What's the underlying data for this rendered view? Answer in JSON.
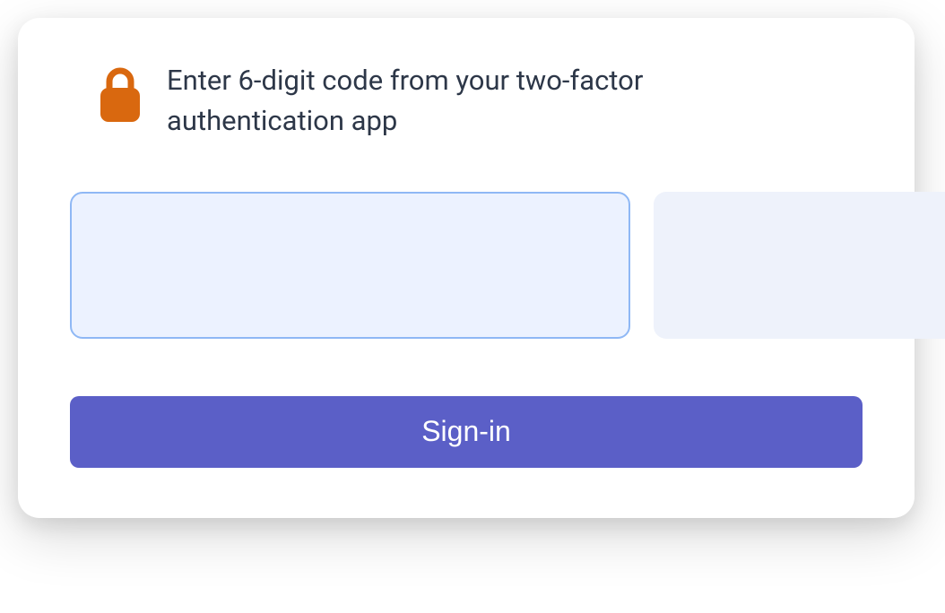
{
  "header": {
    "instruction": "Enter 6-digit code from your two-factor authentication app",
    "icon": "lock-icon"
  },
  "code": {
    "digit1": "",
    "digit2": "",
    "digit3": "",
    "digit4": "",
    "digit5": "",
    "digit6": ""
  },
  "actions": {
    "signin_label": "Sign-in"
  },
  "colors": {
    "accent": "#5b5fc7",
    "lock": "#d9680f",
    "input_bg": "#eef2fb",
    "focus_border": "#8fb8f5",
    "text": "#2d3748"
  }
}
